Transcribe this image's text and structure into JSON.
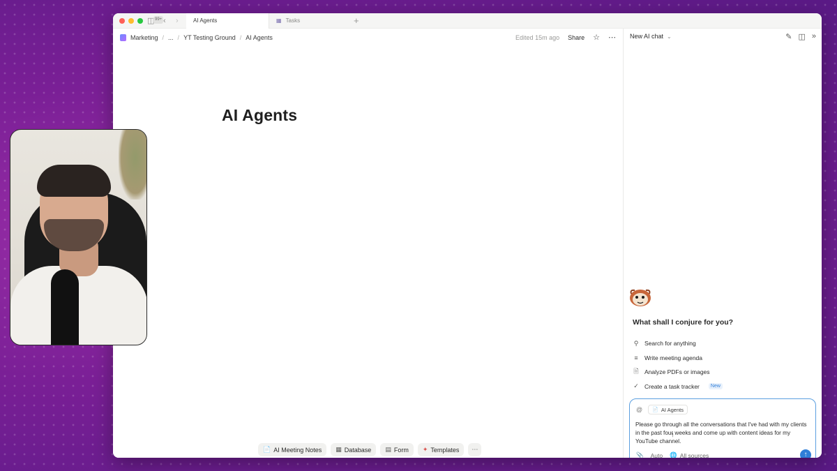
{
  "window": {
    "tabs": [
      {
        "label": "AI Agents",
        "active": true
      },
      {
        "label": "Tasks",
        "active": false
      }
    ],
    "sidebar_badge": "99+"
  },
  "breadcrumb": {
    "items": [
      "Marketing",
      "...",
      "YT Testing Ground",
      "AI Agents"
    ]
  },
  "top_bar": {
    "edited": "Edited 15m ago",
    "share": "Share"
  },
  "page": {
    "title": "AI Agents"
  },
  "quick_actions": [
    {
      "label": "AI Meeting Notes",
      "icon": "meeting-notes-icon"
    },
    {
      "label": "Database",
      "icon": "table-icon"
    },
    {
      "label": "Form",
      "icon": "form-icon"
    },
    {
      "label": "Templates",
      "icon": "templates-icon"
    }
  ],
  "ai_panel": {
    "header": "New AI chat",
    "greeting": "What shall I conjure for you?",
    "suggestions": [
      {
        "label": "Search for anything",
        "icon": "search-icon"
      },
      {
        "label": "Write meeting agenda",
        "icon": "agenda-icon"
      },
      {
        "label": "Analyze PDFs or images",
        "icon": "document-icon"
      },
      {
        "label": "Create a task tracker",
        "icon": "check-circle-icon",
        "badge": "New"
      }
    ],
    "composer": {
      "context_chip": "AI Agents",
      "prompt": "Please go through all the conversations that I've had with my clients in the past four weeks and come up with content ideas for my YouTube channel.",
      "mode": "Auto",
      "sources": "All sources"
    }
  },
  "colors": {
    "accent": "#2f7ed8",
    "background": "#7a1f96"
  }
}
